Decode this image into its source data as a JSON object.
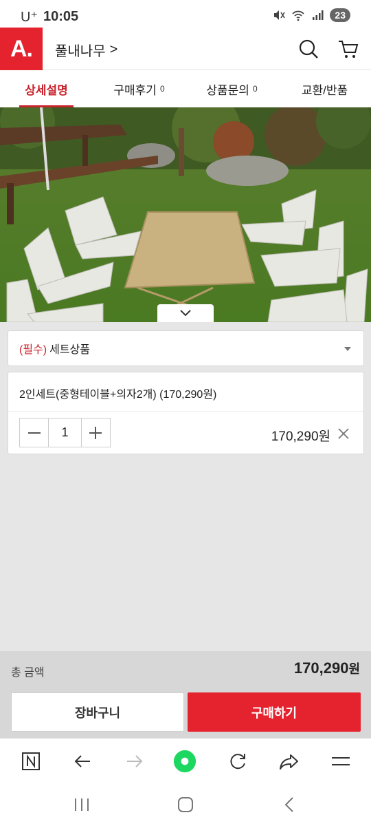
{
  "status_bar": {
    "carrier": "U⁺",
    "time": "10:05",
    "notification_count": "23"
  },
  "header": {
    "logo_text": "A.",
    "store_name": "풀내나무",
    "store_chevron": ">",
    "search_icon": "search-icon",
    "cart_icon": "cart-icon"
  },
  "tabs": [
    {
      "label": "상세설명",
      "count": "",
      "active": true
    },
    {
      "label": "구매후기",
      "count": "0",
      "active": false
    },
    {
      "label": "상품문의",
      "count": "0",
      "active": false
    },
    {
      "label": "교환/반품",
      "count": "",
      "active": false
    }
  ],
  "product_image": {
    "description_icon": "collapse-chevron-icon"
  },
  "option": {
    "required": "(필수)",
    "label": "세트상품"
  },
  "selected_item": {
    "name": "2인세트(중형테이블+의자2개) (170,290원)",
    "quantity": "1",
    "price": "170,290원"
  },
  "total": {
    "label": "총 금액",
    "amount": "170,290",
    "unit": "원"
  },
  "actions": {
    "cart": "장바구니",
    "buy": "구매하기"
  },
  "colors": {
    "brand": "#e5232f",
    "tab_active": "#c8232c",
    "browser_home": "#1ed760"
  }
}
